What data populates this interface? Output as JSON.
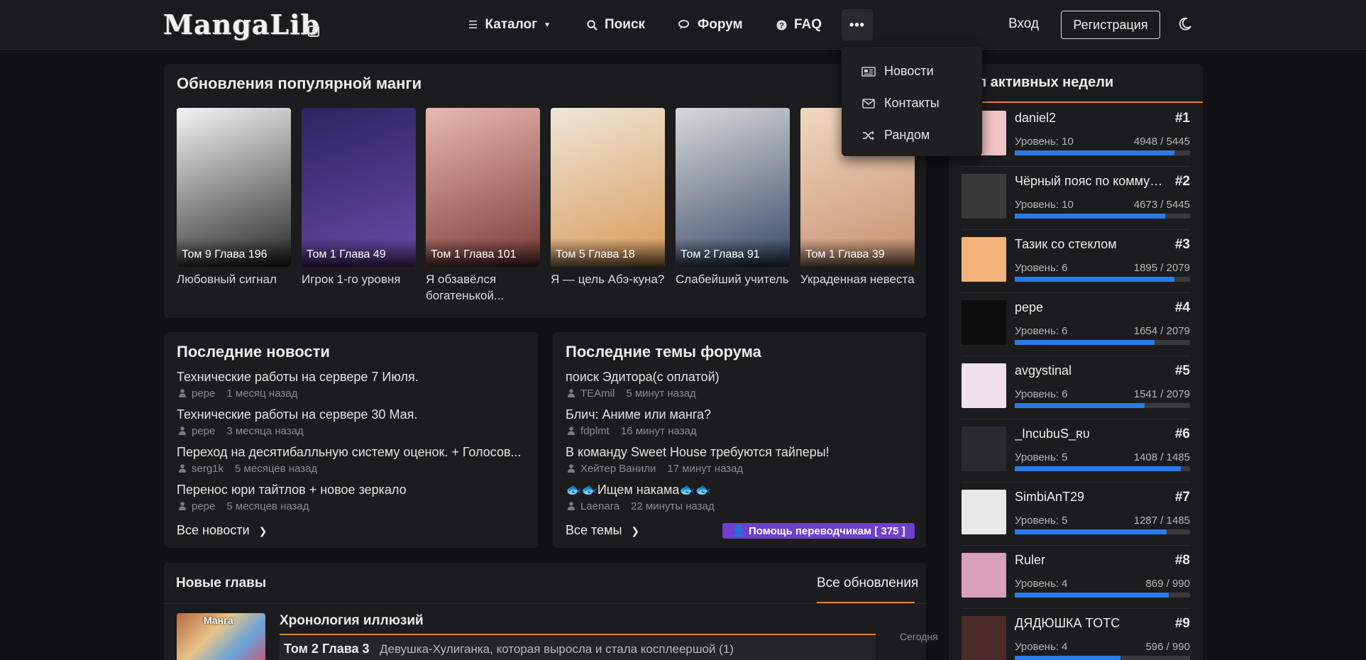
{
  "header": {
    "logo": "MangaLib",
    "nav": [
      {
        "label": "Каталог",
        "icon": "hamburger-icon"
      },
      {
        "label": "Поиск",
        "icon": "search-icon"
      },
      {
        "label": "Форум",
        "icon": "chat-icon"
      },
      {
        "label": "FAQ",
        "icon": "question-icon"
      }
    ],
    "more_label": "•••",
    "login": "Вход",
    "register": "Регистрация",
    "dropdown": [
      {
        "label": "Новости",
        "icon": "newspaper-icon"
      },
      {
        "label": "Контакты",
        "icon": "envelope-icon"
      },
      {
        "label": "Рандом",
        "icon": "shuffle-icon"
      }
    ]
  },
  "popular": {
    "title": "Обновления популярной манги",
    "items": [
      {
        "chapter": "Том 9 Глава 196",
        "title": "Любовный сигнал",
        "colors": [
          "#f4f4f2",
          "#2a2a2a"
        ]
      },
      {
        "chapter": "Том 1 Глава 49",
        "title": "Игрок 1-го уровня",
        "colors": [
          "#2a2560",
          "#6a4aa8"
        ]
      },
      {
        "chapter": "Том 1 Глава 101",
        "title": "Я обзавёлся богатенькой...",
        "colors": [
          "#e9b8b0",
          "#7a3c38"
        ]
      },
      {
        "chapter": "Том 5 Глава 18",
        "title": "Я — цель Абэ-куна?",
        "colors": [
          "#efe6d8",
          "#d89a58"
        ]
      },
      {
        "chapter": "Том 2 Глава 91",
        "title": "Слабейший учитель",
        "colors": [
          "#d8d8d8",
          "#3a4a6a"
        ]
      },
      {
        "chapter": "Том 1 Глава 39",
        "title": "Украденная невеста",
        "colors": [
          "#f0d8c0",
          "#c89070"
        ]
      }
    ]
  },
  "news": {
    "title": "Последние новости",
    "items": [
      {
        "title": "Технические работы на сервере 7 Июля.",
        "author": "pepe",
        "time": "1 месяц назад"
      },
      {
        "title": "Технические работы на сервере 30 Мая.",
        "author": "pepe",
        "time": "3 месяца назад"
      },
      {
        "title": "Переход на десятибалльную систему оценок. + Голосов...",
        "author": "serg1k",
        "time": "5 месяцев назад"
      },
      {
        "title": "Перенос юри тайтлов + новое зеркало",
        "author": "pepe",
        "time": "5 месяцев назад"
      }
    ],
    "more": "Все новости"
  },
  "forum": {
    "title": "Последние темы форума",
    "items": [
      {
        "title": "поиск Эдитора(с оплатой)",
        "author": "TEAmil",
        "time": "5 минут назад"
      },
      {
        "title": "Блич: Аниме или манга?",
        "author": "fdplmt",
        "time": "16 минут назад"
      },
      {
        "title": "В команду Sweet House требуются тайперы!",
        "author": "Хейтер Ванили",
        "time": "17 минут назад"
      },
      {
        "title": "🐟🐟Ищем накама🐟🐟",
        "author": "Laenara",
        "time": "22 минуты назад"
      }
    ],
    "more": "Все темы",
    "help": "Помощь переводчикам [ 375 ]"
  },
  "new_chapters": {
    "title": "Новые главы",
    "tab": "Все обновления",
    "item": {
      "badge": "Манга",
      "title": "Хронология иллюзий",
      "chapter": "Том 2 Глава 3",
      "chapter_title": "Девушка-Хулиганка, которая выросла и стала косплеершой (1)",
      "date": "Сегодня"
    }
  },
  "top_users": {
    "title": "Топ активных недели",
    "items": [
      {
        "name": "daniel2",
        "rank": "#1",
        "level": "Уровень: 10",
        "xp": "4948 / 5445",
        "progress": 0.909,
        "avatar_color": "#f3c6c6"
      },
      {
        "name": "Чёрный пояс по коммуникации",
        "rank": "#2",
        "level": "Уровень: 10",
        "xp": "4673 / 5445",
        "progress": 0.858,
        "avatar_color": "#3a3a3a"
      },
      {
        "name": "Тазик со стеклом",
        "rank": "#3",
        "level": "Уровень: 6",
        "xp": "1895 / 2079",
        "progress": 0.911,
        "avatar_color": "#f2b27a"
      },
      {
        "name": "pepe",
        "rank": "#4",
        "level": "Уровень: 6",
        "xp": "1654 / 2079",
        "progress": 0.796,
        "avatar_color": "#0d0d0d"
      },
      {
        "name": "avgystinal",
        "rank": "#5",
        "level": "Уровень: 6",
        "xp": "1541 / 2079",
        "progress": 0.741,
        "avatar_color": "#f0e0e8"
      },
      {
        "name": "_IncubuS_ʀᴜ",
        "rank": "#6",
        "level": "Уровень: 5",
        "xp": "1408 / 1485",
        "progress": 0.948,
        "avatar_color": "#2a2a30"
      },
      {
        "name": "SimbiAnT29",
        "rank": "#7",
        "level": "Уровень: 5",
        "xp": "1287 / 1485",
        "progress": 0.867,
        "avatar_color": "#e8e8e8"
      },
      {
        "name": "Ruler",
        "rank": "#8",
        "level": "Уровень: 4",
        "xp": "869 / 990",
        "progress": 0.878,
        "avatar_color": "#d9a0b8"
      },
      {
        "name": "ДЯДЮШКА TOTC",
        "rank": "#9",
        "level": "Уровень: 4",
        "xp": "596 / 990",
        "progress": 0.602,
        "avatar_color": "#4a2a28"
      }
    ]
  },
  "colors": {
    "accent": "#e5842b",
    "progress": "#2a7ce8",
    "help_badge": "#6f3fd0"
  }
}
